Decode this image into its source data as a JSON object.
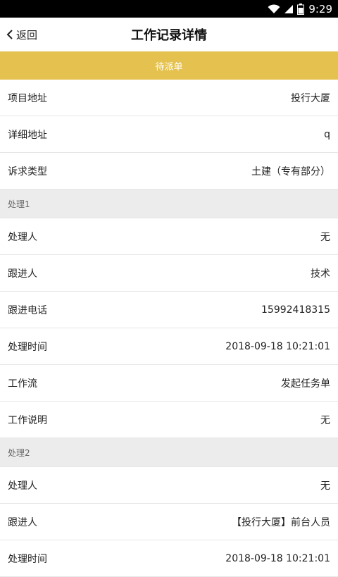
{
  "status_bar": {
    "time": "9:29"
  },
  "nav": {
    "back_label": "返回",
    "title": "工作记录详情"
  },
  "banner": {
    "label": "待派单",
    "color": "#e5c24f"
  },
  "info": [
    {
      "label": "项目地址",
      "value": "投行大厦"
    },
    {
      "label": "详细地址",
      "value": "q"
    },
    {
      "label": "诉求类型",
      "value": "土建（专有部分）"
    }
  ],
  "processes": [
    {
      "title": "处理1",
      "rows": [
        {
          "label": "处理人",
          "value": "无"
        },
        {
          "label": "跟进人",
          "value": "技术"
        },
        {
          "label": "跟进电话",
          "value": "15992418315"
        },
        {
          "label": "处理时间",
          "value": "2018-09-18 10:21:01"
        },
        {
          "label": "工作流",
          "value": "发起任务单"
        },
        {
          "label": "工作说明",
          "value": "无"
        }
      ]
    },
    {
      "title": "处理2",
      "rows": [
        {
          "label": "处理人",
          "value": "无"
        },
        {
          "label": "跟进人",
          "value": "【投行大厦】前台人员"
        },
        {
          "label": "处理时间",
          "value": "2018-09-18 10:21:01"
        }
      ]
    }
  ]
}
